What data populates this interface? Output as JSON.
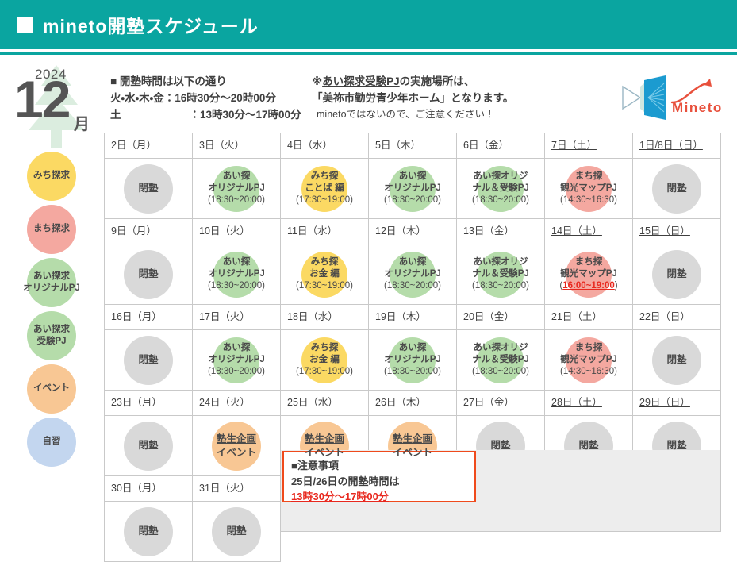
{
  "header": {
    "title": "mineto開塾スケジュール",
    "bullet_icon": "square-bullet-icon",
    "bg_color": "#0aa5a0"
  },
  "calendar_meta": {
    "year": "2024",
    "month_number": "12",
    "month_suffix": "月"
  },
  "notes": {
    "hours_heading": "■ 開塾時間は以下の通り",
    "hours_line1": "火・水・木・金：16時30分～20時00分",
    "hours_line2_label": "土",
    "hours_line2_value": "：13時30分～17時00分",
    "venue_line1_prefix": "※",
    "venue_line1_underlined": "あい探求受験PJ",
    "venue_line1_suffix": "の実施場所は、",
    "venue_line2": "「美祢市勤労青少年ホーム」となります。",
    "venue_line3": "minetoではないので、ご注意ください！"
  },
  "logo": {
    "name": "mineto-logo",
    "wordmark": "Mineto",
    "wordmark_color": "#e8503c",
    "fan_color": "#1b9bd0"
  },
  "legend": {
    "items": [
      {
        "label": "みち探求",
        "color": "#fbd963",
        "name": "legend-michi-tankyu",
        "wide": false
      },
      {
        "label": "まち探求",
        "color": "#f4a8a0",
        "name": "legend-machi-tankyu",
        "wide": false
      },
      {
        "label_line1": "あい探求",
        "label_line2": "オリジナルPJ",
        "color": "#b5dcaa",
        "name": "legend-ai-tankyu-original-pj",
        "wide": true
      },
      {
        "label_line1": "あい探求",
        "label_line2": "受験PJ",
        "color": "#b5dcaa",
        "name": "legend-ai-tankyu-juken-pj",
        "wide": false
      },
      {
        "label": "イベント",
        "color": "#f8c794",
        "name": "legend-event",
        "wide": false
      },
      {
        "label": "自習",
        "color": "#c3d6ef",
        "name": "legend-jishu",
        "wide": false
      }
    ]
  },
  "colors": {
    "closed_gray": "#d9d9d9",
    "green": "#b5dcaa",
    "yellow": "#fbd963",
    "pink": "#f4a8a0",
    "orange": "#f8c794",
    "saturday_blue": "#2a72d4",
    "sunday_red": "#e8281e",
    "alert_red": "#ef4a1c"
  },
  "weeks": [
    {
      "dates": [
        {
          "text": "2日（月）",
          "kind": "weekday"
        },
        {
          "text": "3日（火）",
          "kind": "weekday"
        },
        {
          "text": "4日（水）",
          "kind": "weekday"
        },
        {
          "text": "5日（木）",
          "kind": "weekday"
        },
        {
          "text": "6日（金）",
          "kind": "weekday"
        },
        {
          "text": "7日（土）",
          "kind": "sat"
        },
        {
          "text": "1日/8日（日）",
          "kind": "sun"
        }
      ],
      "events": [
        {
          "type": "closed",
          "label": "閉塾"
        },
        {
          "type": "event",
          "color": "green",
          "line1": "あい探",
          "line2": "オリジナルPJ",
          "time": "(18:30~20:00)",
          "time_alert": false
        },
        {
          "type": "event",
          "color": "yellow",
          "line1": "みち探",
          "line2": "ことば 編",
          "time": "(17:30~19:00)",
          "time_alert": false
        },
        {
          "type": "event",
          "color": "green",
          "line1": "あい探",
          "line2": "オリジナルPJ",
          "time": "(18:30~20:00)",
          "time_alert": false
        },
        {
          "type": "event",
          "color": "green",
          "line1": "あい探オリジ",
          "line2": "ナル＆受験PJ",
          "time": "(18:30~20:00)",
          "time_alert": false
        },
        {
          "type": "event",
          "color": "pink",
          "line1": "まち探",
          "line2": "観光マップPJ",
          "time": "(14:30~16:30)",
          "time_alert": false
        },
        {
          "type": "closed",
          "label": "閉塾"
        }
      ]
    },
    {
      "dates": [
        {
          "text": "9日（月）",
          "kind": "weekday"
        },
        {
          "text": "10日（火）",
          "kind": "weekday"
        },
        {
          "text": "11日（水）",
          "kind": "weekday"
        },
        {
          "text": "12日（木）",
          "kind": "weekday"
        },
        {
          "text": "13日（金）",
          "kind": "weekday"
        },
        {
          "text": "14日（土）",
          "kind": "sat"
        },
        {
          "text": "15日（日）",
          "kind": "sun"
        }
      ],
      "events": [
        {
          "type": "closed",
          "label": "閉塾"
        },
        {
          "type": "event",
          "color": "green",
          "line1": "あい探",
          "line2": "オリジナルPJ",
          "time": "(18:30~20:00)",
          "time_alert": false
        },
        {
          "type": "event",
          "color": "yellow",
          "line1": "みち探",
          "line2": "お金 編",
          "time": "(17:30~19:00)",
          "time_alert": false
        },
        {
          "type": "event",
          "color": "green",
          "line1": "あい探",
          "line2": "オリジナルPJ",
          "time": "(18:30~20:00)",
          "time_alert": false
        },
        {
          "type": "event",
          "color": "green",
          "line1": "あい探オリジ",
          "line2": "ナル＆受験PJ",
          "time": "(18:30~20:00)",
          "time_alert": false
        },
        {
          "type": "event",
          "color": "pink",
          "line1": "まち探",
          "line2": "観光マップPJ",
          "time": "(16:00~19:00)",
          "time_alert": true
        },
        {
          "type": "closed",
          "label": "閉塾"
        }
      ]
    },
    {
      "dates": [
        {
          "text": "16日（月）",
          "kind": "weekday"
        },
        {
          "text": "17日（火）",
          "kind": "weekday"
        },
        {
          "text": "18日（水）",
          "kind": "weekday"
        },
        {
          "text": "19日（木）",
          "kind": "weekday"
        },
        {
          "text": "20日（金）",
          "kind": "weekday"
        },
        {
          "text": "21日（土）",
          "kind": "sat"
        },
        {
          "text": "22日（日）",
          "kind": "sun"
        }
      ],
      "events": [
        {
          "type": "closed",
          "label": "閉塾"
        },
        {
          "type": "event",
          "color": "green",
          "line1": "あい探",
          "line2": "オリジナルPJ",
          "time": "(18:30~20:00)",
          "time_alert": false
        },
        {
          "type": "event",
          "color": "yellow",
          "line1": "みち探",
          "line2": "お金 編",
          "time": "(17:30~19:00)",
          "time_alert": false
        },
        {
          "type": "event",
          "color": "green",
          "line1": "あい探",
          "line2": "オリジナルPJ",
          "time": "(18:30~20:00)",
          "time_alert": false
        },
        {
          "type": "event",
          "color": "green",
          "line1": "あい探オリジ",
          "line2": "ナル＆受験PJ",
          "time": "(18:30~20:00)",
          "time_alert": false
        },
        {
          "type": "event",
          "color": "pink",
          "line1": "まち探",
          "line2": "観光マップPJ",
          "time": "(14:30~16:30)",
          "time_alert": false
        },
        {
          "type": "closed",
          "label": "閉塾"
        }
      ]
    },
    {
      "dates": [
        {
          "text": "23日（月）",
          "kind": "weekday"
        },
        {
          "text": "24日（火）",
          "kind": "weekday"
        },
        {
          "text": "25日（水）",
          "kind": "weekday"
        },
        {
          "text": "26日（木）",
          "kind": "weekday"
        },
        {
          "text": "27日（金）",
          "kind": "weekday"
        },
        {
          "text": "28日（土）",
          "kind": "sat"
        },
        {
          "text": "29日（日）",
          "kind": "sun"
        }
      ],
      "events": [
        {
          "type": "closed",
          "label": "閉塾"
        },
        {
          "type": "event_plain",
          "color": "orange",
          "line1": "塾生企画",
          "line2": "イベント"
        },
        {
          "type": "event_plain",
          "color": "orange",
          "line1": "塾生企画",
          "line2": "イベント"
        },
        {
          "type": "event_plain",
          "color": "orange",
          "line1": "塾生企画",
          "line2": "イベント"
        },
        {
          "type": "closed",
          "label": "閉塾"
        },
        {
          "type": "closed",
          "label": "閉塾"
        },
        {
          "type": "closed",
          "label": "閉塾"
        }
      ]
    },
    {
      "dates": [
        {
          "text": "30日（月）",
          "kind": "weekday"
        },
        {
          "text": "31日（火）",
          "kind": "weekday"
        }
      ],
      "events": [
        {
          "type": "closed",
          "label": "閉塾"
        },
        {
          "type": "closed",
          "label": "閉塾"
        }
      ]
    }
  ],
  "notice": {
    "heading": "■注意事項",
    "line2": "25日/26日の開塾時間は",
    "line3": "13時30分～17時00分"
  }
}
